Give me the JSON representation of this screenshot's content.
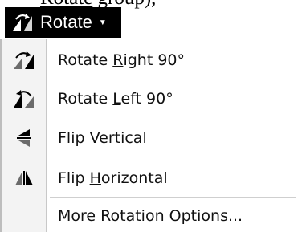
{
  "document": {
    "visible_text_prefix": "",
    "visible_text_underlined": "Rotate",
    "visible_text_suffix": " group),"
  },
  "rotate_button": {
    "label": "Rotate",
    "icon": "rotate-object-icon",
    "background": "#000000",
    "text_color": "#ffffff"
  },
  "menu": {
    "items": [
      {
        "label_pre": "Rotate ",
        "label_mnemonic": "R",
        "label_post": "ight 90°",
        "icon": "rotate-right-icon"
      },
      {
        "label_pre": "Rotate ",
        "label_mnemonic": "L",
        "label_post": "eft 90°",
        "icon": "rotate-left-icon"
      },
      {
        "label_pre": "Flip ",
        "label_mnemonic": "V",
        "label_post": "ertical",
        "icon": "flip-vertical-icon"
      },
      {
        "label_pre": "Flip ",
        "label_mnemonic": "H",
        "label_post": "orizontal",
        "icon": "flip-horizontal-icon"
      }
    ],
    "more": {
      "label_pre": "",
      "label_mnemonic": "M",
      "label_post": "ore Rotation Options..."
    }
  }
}
